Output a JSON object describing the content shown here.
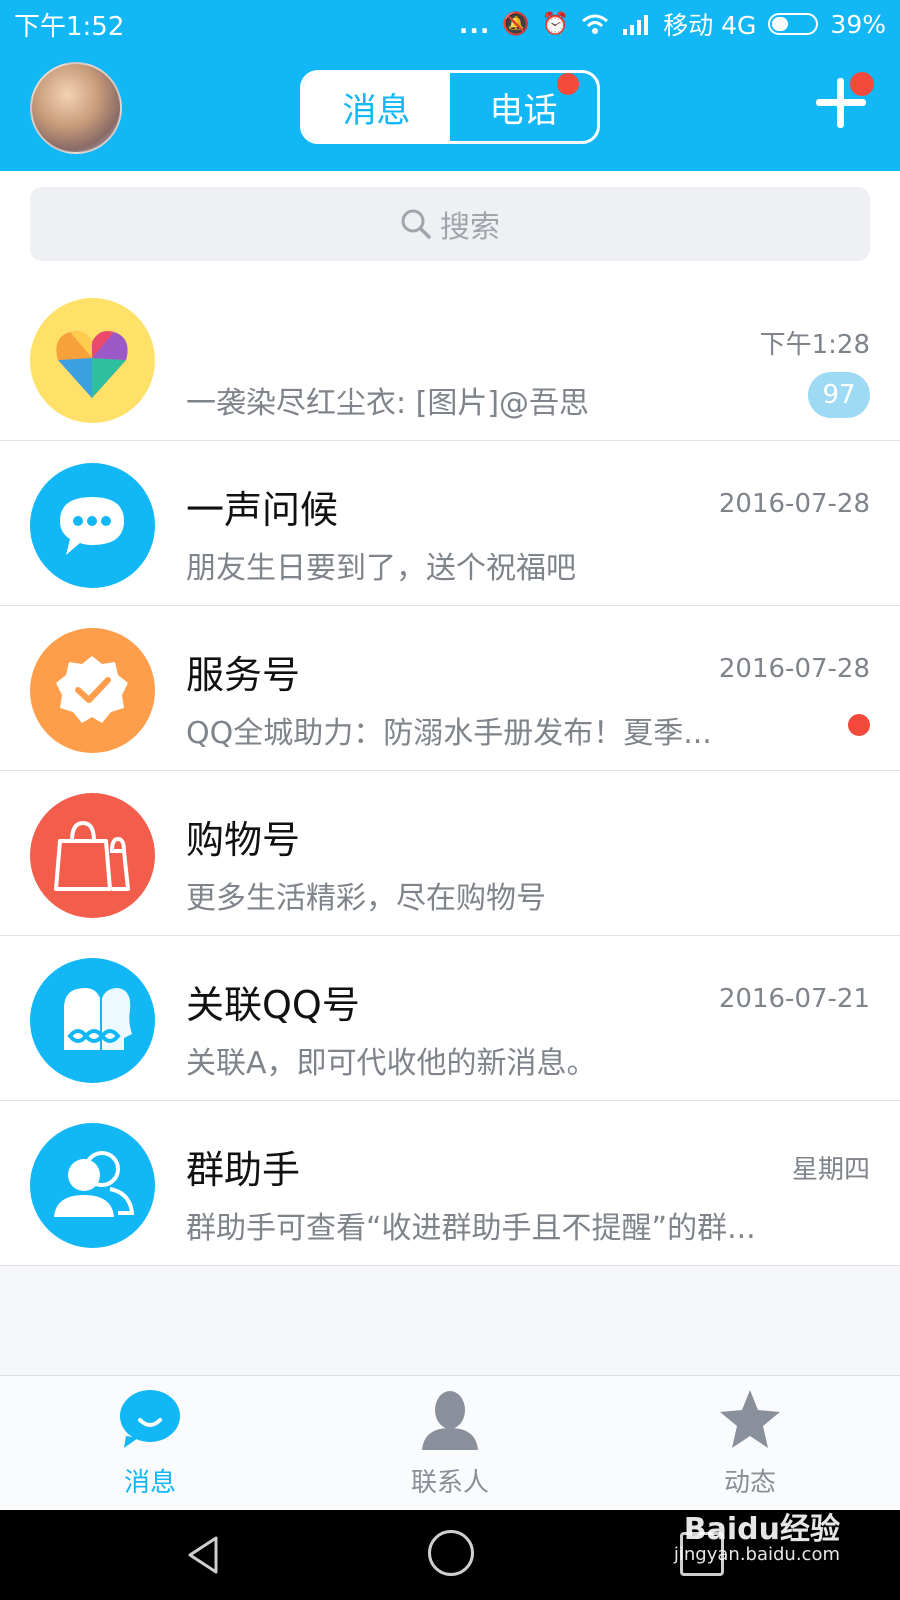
{
  "status_bar": {
    "time": "下午1:52",
    "dots": "...",
    "carrier": "移动 4G",
    "battery": "39%",
    "battery_level": 0.39
  },
  "header": {
    "tabs": [
      {
        "label": "消息",
        "active": true
      },
      {
        "label": "电话",
        "active": false,
        "has_dot": true
      }
    ],
    "accent": "#12b7f5",
    "dot_color": "#f5493c"
  },
  "search": {
    "placeholder": "搜索"
  },
  "conversations": [
    {
      "name": "",
      "time": "下午1:28",
      "preview": "一袭染尽红尘衣: [图片]@吾思",
      "badge": "97",
      "icon": "heart-icon"
    },
    {
      "name": "一声问候",
      "time": "2016-07-28",
      "preview": "朋友生日要到了，送个祝福吧",
      "icon": "chat-bubble-icon"
    },
    {
      "name": "服务号",
      "time": "2016-07-28",
      "preview": "QQ全城助力：防溺水手册发布！夏季...",
      "unread_dot": true,
      "icon": "service-badge-icon"
    },
    {
      "name": "购物号",
      "time": "",
      "preview": "更多生活精彩，尽在购物号",
      "icon": "shopping-bag-icon"
    },
    {
      "name": "关联QQ号",
      "time": "2016-07-21",
      "preview": "关联A，即可代收他的新消息。",
      "icon": "linked-account-icon"
    },
    {
      "name": "群助手",
      "time": "星期四",
      "preview": "群助手可查看“收进群助手且不提醒”的群...",
      "icon": "group-helper-icon"
    }
  ],
  "tabbar": {
    "items": [
      {
        "label": "消息",
        "icon": "message-icon",
        "active": true
      },
      {
        "label": "联系人",
        "icon": "contacts-icon",
        "active": false
      },
      {
        "label": "动态",
        "icon": "star-icon",
        "active": false
      }
    ]
  },
  "watermark": {
    "brand": "Baidu经验",
    "url": "jingyan.baidu.com"
  }
}
